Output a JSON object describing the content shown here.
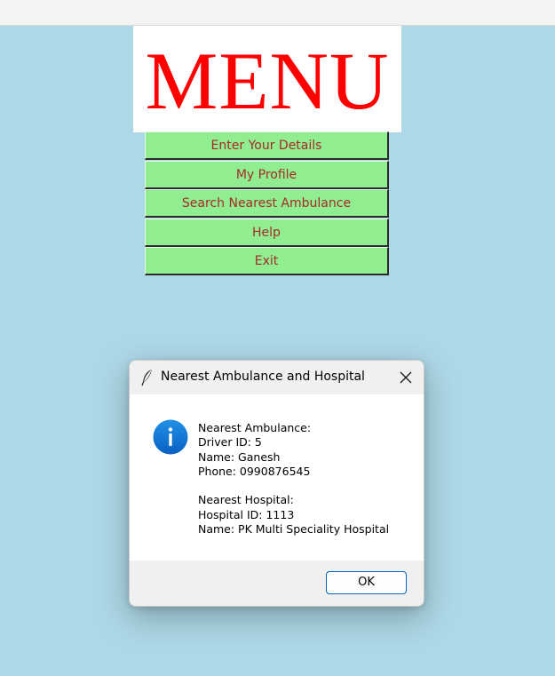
{
  "banner": {
    "text": "MENU",
    "color": "#ff0000"
  },
  "menu": {
    "button_bg": "#90ee90",
    "button_fg": "#a52a2a",
    "items": [
      {
        "label": "Enter Your Details"
      },
      {
        "label": "My Profile"
      },
      {
        "label": "Search Nearest Ambulance"
      },
      {
        "label": "Help"
      },
      {
        "label": "Exit"
      }
    ]
  },
  "dialog": {
    "title": "Nearest Ambulance and Hospital",
    "icon": "info-icon",
    "message": "Nearest Ambulance:\nDriver ID: 5\nName: Ganesh\nPhone: 0990876545\n\nNearest Hospital:\nHospital ID: 1113\nName: PK Multi Speciality Hospital",
    "ok_label": "OK",
    "accent": "#0067c0"
  },
  "background": "#add8e6"
}
